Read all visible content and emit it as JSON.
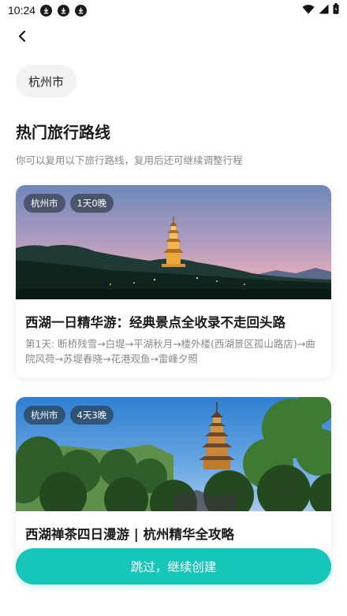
{
  "status_bar": {
    "time": "10:24"
  },
  "city_chip": {
    "label": "杭州市"
  },
  "section": {
    "title": "热门旅行路线",
    "subtitle": "你可以复用以下旅行路线，复用后还可继续调整行程"
  },
  "routes": [
    {
      "city_tag": "杭州市",
      "duration_tag": "1天0晚",
      "title": "西湖一日精华游：经典景点全收录不走回头路",
      "description": "第1天: 断桥残雪→白堤→平湖秋月→楼外楼(西湖景区孤山路店)→曲院风荷→苏堤春晓→花港观鱼→雷峰夕照"
    },
    {
      "city_tag": "杭州市",
      "duration_tag": "4天3晚",
      "title": "西湖禅茶四日漫游 | 杭州精华全攻略"
    }
  ],
  "cta": {
    "label": "跳过，继续创建"
  },
  "colors": {
    "accent": "#16c6b8",
    "chip_bg": "#f2f2f2",
    "subtitle": "#888888"
  }
}
